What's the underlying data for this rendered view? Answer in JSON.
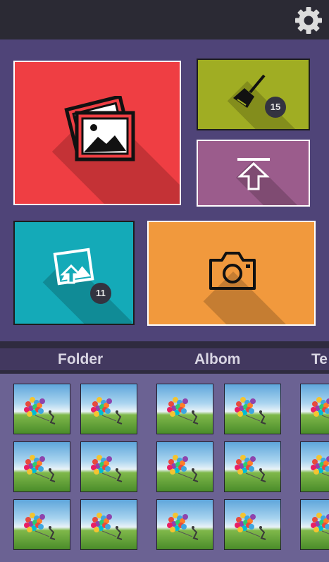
{
  "header": {
    "settings_icon": "gear-icon"
  },
  "tiles": [
    {
      "name": "gallery",
      "icon": "pictures-icon",
      "color": "#ef3e43"
    },
    {
      "name": "cleaner",
      "icon": "broom-icon",
      "color": "#a0ad23",
      "badge": "15"
    },
    {
      "name": "upload",
      "icon": "upload-arrow-icon",
      "color": "#9b5c8c"
    },
    {
      "name": "import",
      "icon": "photo-upload-icon",
      "color": "#14aab8",
      "badge": "11"
    },
    {
      "name": "camera",
      "icon": "camera-icon",
      "color": "#f1993d"
    }
  ],
  "tabs": [
    "Folder",
    "Albom",
    "Te"
  ],
  "thumbnail": {
    "icon": "balloons-photo"
  },
  "colors": {
    "background": "#4f4478",
    "topbar": "#2b2a34",
    "tabbar": "#42385f",
    "grid": "#6b6293"
  }
}
